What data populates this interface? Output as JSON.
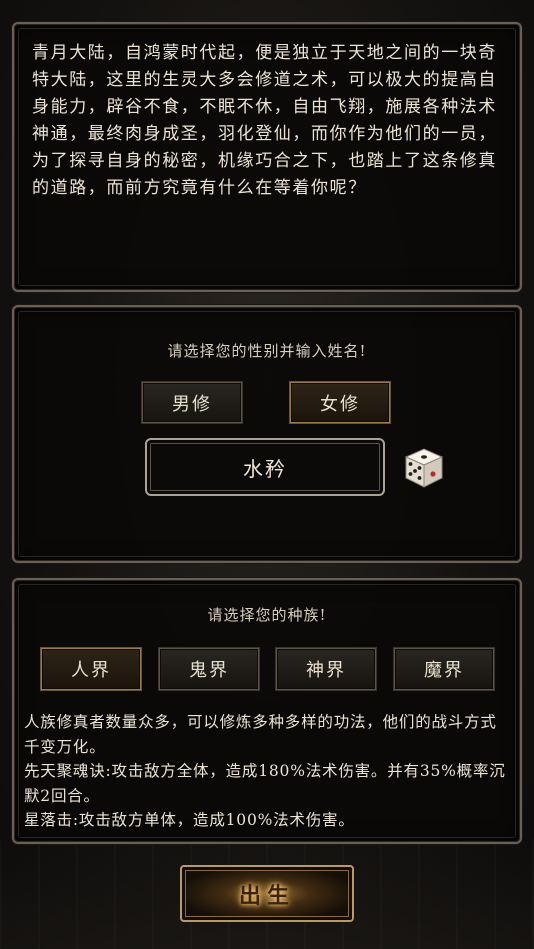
{
  "story": {
    "text": "青月大陆，自鸿蒙时代起，便是独立于天地之间的一块奇特大陆，这里的生灵大多会修道之术，可以极大的提高自身能力，辟谷不食，不眠不休，自由飞翔，施展各种法术神通，最终肉身成圣，羽化登仙，而你作为他们的一员，为了探寻自身的秘密，机缘巧合之下，也踏上了这条修真的道路，而前方究竟有什么在等着你呢？"
  },
  "gender": {
    "prompt": "请选择您的性别并输入姓名!",
    "male_label": "男修",
    "female_label": "女修",
    "selected": "female",
    "name_value": "水矜"
  },
  "race": {
    "prompt": "请选择您的种族!",
    "options": [
      "人界",
      "鬼界",
      "神界",
      "魔界"
    ],
    "selected_index": 0,
    "description": [
      "人族修真者数量众多，可以修炼多种多样的功法，他们的战斗方式千变万化。",
      "先天聚魂诀:攻击敌方全体，造成180%法术伤害。并有35%概率沉默2回合。",
      "星落击:攻击敌方单体，造成100%法术伤害。"
    ]
  },
  "actions": {
    "birth_label": "出生"
  },
  "colors": {
    "accent_gold": "#b69a6a",
    "selected_border": "#9a7b4e",
    "text_primary": "#ece3d4",
    "dice_pip_red": "#c0282a"
  }
}
